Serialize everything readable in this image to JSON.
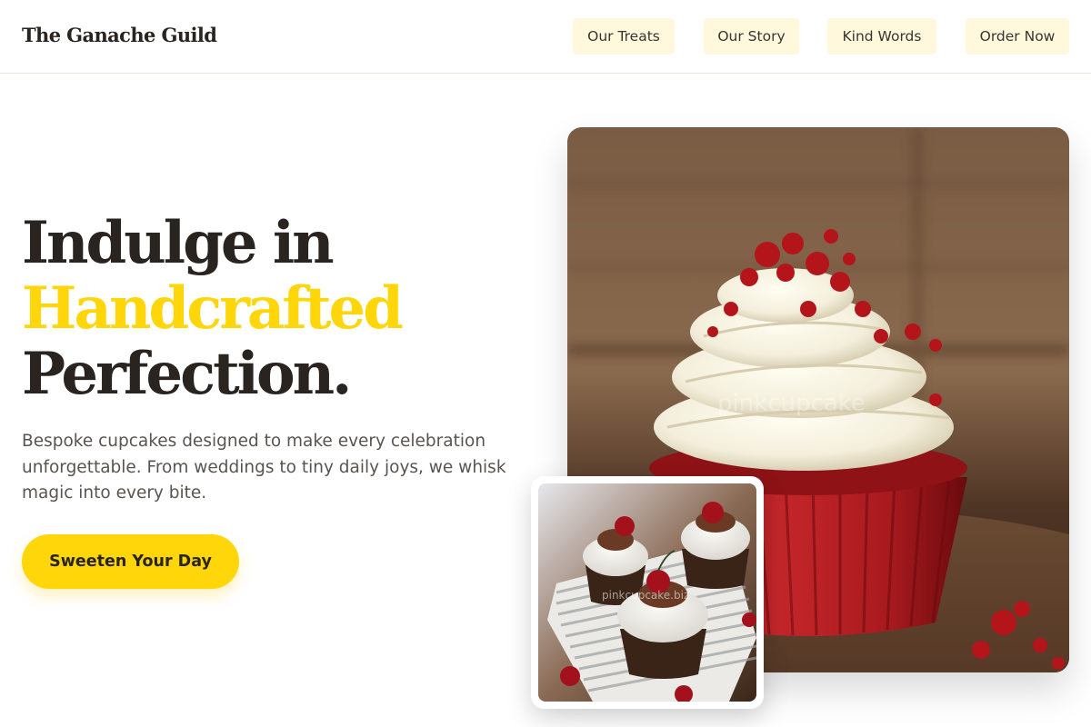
{
  "header": {
    "brand": "The Ganache Guild",
    "nav": [
      "Our Treats",
      "Our Story",
      "Kind Words",
      "Order Now"
    ]
  },
  "hero": {
    "headline_line1": "Indulge in",
    "headline_line2": "Handcrafted",
    "headline_line3": "Perfection.",
    "description": "Bespoke cupcakes designed to make every celebration unforgettable. From weddings to tiny daily joys, we whisk magic into every bite.",
    "cta_label": "Sweeten Your Day"
  },
  "images": {
    "main_watermark": "pinkcupcake",
    "inset_watermark": "pinkcupcake.biz"
  },
  "colors": {
    "accent": "#ffd60a",
    "nav_bg": "#fff8dc",
    "text_dark": "#2a2420",
    "text_muted": "#5a5450"
  }
}
